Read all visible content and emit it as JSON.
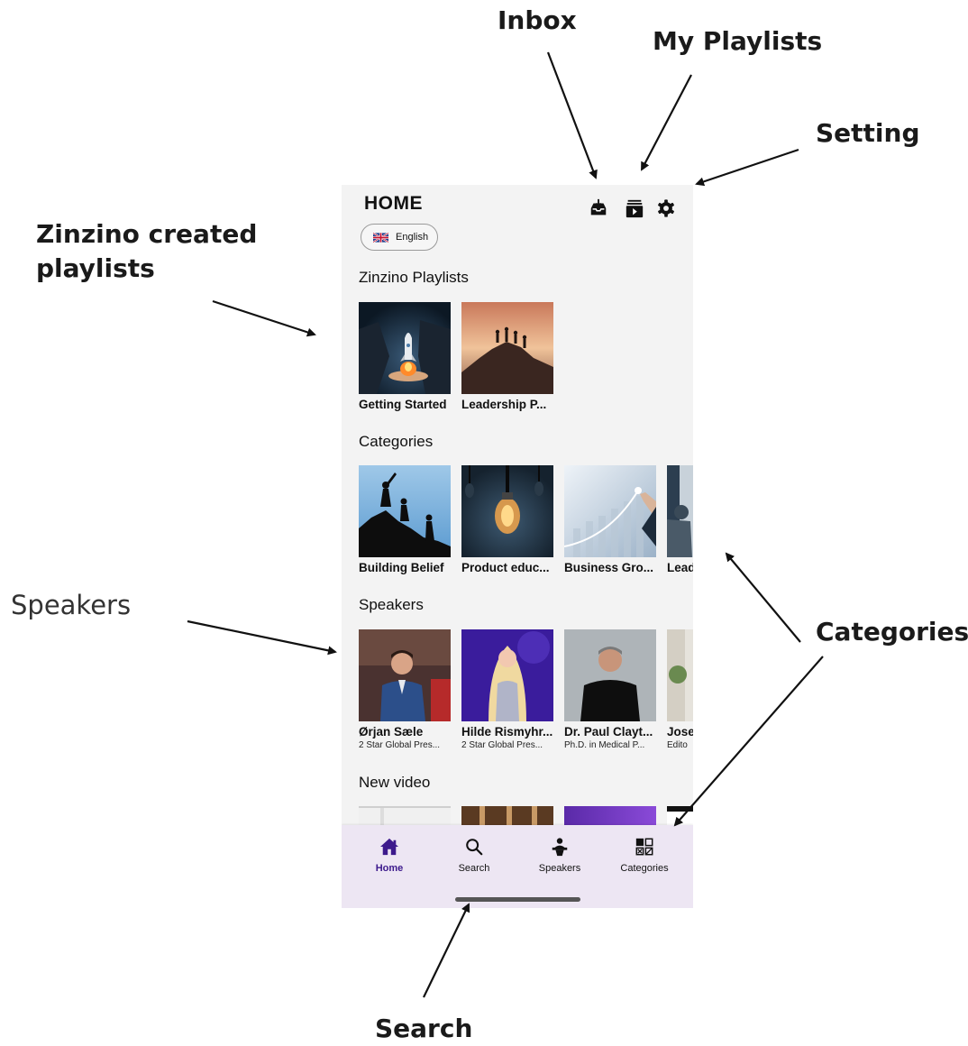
{
  "annotations": {
    "inbox": "Inbox",
    "my_playlists": "My Playlists",
    "setting": "Setting",
    "zinzino_created": "Zinzino created playlists",
    "speakers": "Speakers",
    "categories": "Categories",
    "search": "Search"
  },
  "header": {
    "title": "HOME",
    "language": "English",
    "icons": [
      "inbox-icon",
      "my-playlists-icon",
      "settings-icon"
    ]
  },
  "sections": {
    "zinzino_playlists": {
      "title": "Zinzino Playlists",
      "items": [
        {
          "label": "Getting Started"
        },
        {
          "label": "Leadership P..."
        }
      ]
    },
    "categories": {
      "title": "Categories",
      "items": [
        {
          "label": "Building Belief"
        },
        {
          "label": "Product educ..."
        },
        {
          "label": "Business Gro..."
        },
        {
          "label": "Lead"
        }
      ]
    },
    "speakers": {
      "title": "Speakers",
      "items": [
        {
          "name": "Ørjan Sæle",
          "role": "2 Star Global Pres..."
        },
        {
          "name": "Hilde Rismyhr...",
          "role": "2 Star Global Pres..."
        },
        {
          "name": "Dr. Paul Clayt...",
          "role": "Ph.D. in Medical P..."
        },
        {
          "name": "Jose",
          "role": "Edito"
        }
      ]
    },
    "new_video": {
      "title": "New video"
    }
  },
  "bottom_nav": {
    "items": [
      {
        "label": "Home",
        "icon": "home-icon",
        "active": true
      },
      {
        "label": "Search",
        "icon": "search-icon"
      },
      {
        "label": "Speakers",
        "icon": "speaker-icon"
      },
      {
        "label": "Categories",
        "icon": "categories-icon"
      }
    ]
  },
  "colors": {
    "active_nav": "#3d1a8c",
    "nav_background": "#ede6f3",
    "screen_background": "#f3f3f3"
  }
}
